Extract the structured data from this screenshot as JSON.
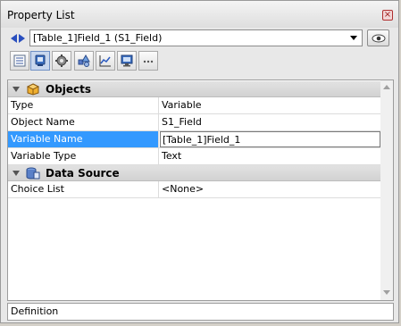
{
  "window": {
    "title": "Property List",
    "close_icon": "close-icon"
  },
  "selector": {
    "current_object": "[Table_1]Field_1 (S1_Field)",
    "nav_icon": "prev-next-arrows-icon",
    "eye_icon": "eye-icon"
  },
  "themes": [
    {
      "name": "list-theme-icon",
      "active": false
    },
    {
      "name": "display-theme-icon",
      "active": true
    },
    {
      "name": "settings-theme-icon",
      "active": false
    },
    {
      "name": "shapes-theme-icon",
      "active": false
    },
    {
      "name": "graph-theme-icon",
      "active": false
    },
    {
      "name": "monitor-theme-icon",
      "active": false
    },
    {
      "name": "more-theme-icon",
      "active": false
    }
  ],
  "sections": {
    "objects": {
      "label": "Objects",
      "icon": "cube-icon",
      "rows": [
        {
          "name": "Type",
          "value": "Variable"
        },
        {
          "name": "Object Name",
          "value": "S1_Field"
        },
        {
          "name": "Variable Name",
          "value": "[Table_1]Field_1"
        },
        {
          "name": "Variable Type",
          "value": "Text"
        }
      ]
    },
    "data_source": {
      "label": "Data Source",
      "icon": "database-icon",
      "rows": [
        {
          "name": "Choice List",
          "value": "<None>"
        }
      ]
    }
  },
  "definition": {
    "label": "Definition"
  },
  "colors": {
    "selection": "#3399ff",
    "accent": "#2a4fbf"
  }
}
